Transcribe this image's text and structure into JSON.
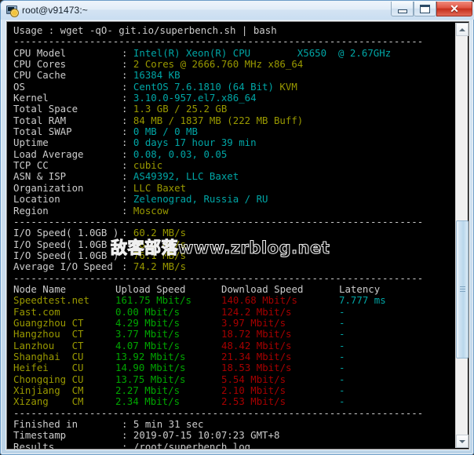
{
  "window": {
    "title": "root@v91473:~",
    "icon": "terminal-icon",
    "controls": {
      "minimize": "–",
      "maximize": "□",
      "close": "✕"
    }
  },
  "terminal": {
    "usage_line": "Usage : wget -qO- git.io/superbench.sh | bash",
    "divider": "----------------------------------------------------------------------",
    "sysinfo": [
      {
        "label": "CPU Model",
        "value": "Intel(R) Xeon(R) CPU        X5650  @ 2.67GHz",
        "color": "cyan"
      },
      {
        "label": "CPU Cores",
        "value": "2 Cores @ 2666.760 MHz x86_64",
        "color": "yellow"
      },
      {
        "label": "CPU Cache",
        "value": "16384 KB",
        "color": "cyan"
      },
      {
        "label": "OS",
        "value": "CentOS 7.6.1810 (64 Bit) ",
        "value2": "KVM",
        "color": "cyan",
        "color2": "yellow"
      },
      {
        "label": "Kernel",
        "value": "3.10.0-957.el7.x86_64",
        "color": "cyan"
      },
      {
        "label": "Total Space",
        "value": "1.3 GB / 25.2 GB",
        "color": "yellow"
      },
      {
        "label": "Total RAM",
        "value": "84 MB / 1837 MB (222 MB Buff)",
        "color": "yellow"
      },
      {
        "label": "Total SWAP",
        "value": "0 MB / 0 MB",
        "color": "cyan"
      },
      {
        "label": "Uptime",
        "value": "0 days 17 hour 39 min",
        "color": "cyan"
      },
      {
        "label": "Load Average",
        "value": "0.08, 0.03, 0.05",
        "color": "cyan"
      },
      {
        "label": "TCP CC",
        "value": "cubic",
        "color": "yellow"
      },
      {
        "label": "ASN & ISP",
        "value": "AS49392, LLC Baxet",
        "color": "cyan"
      },
      {
        "label": "Organization",
        "value": "LLC Baxet",
        "color": "yellow"
      },
      {
        "label": "Location",
        "value": "Zelenograd, Russia / RU",
        "color": "cyan"
      },
      {
        "label": "Region",
        "value": "Moscow",
        "color": "yellow"
      }
    ],
    "io": [
      {
        "label": "I/O Speed( 1.0GB )",
        "value": "60.2 MB/s",
        "color": "yellow"
      },
      {
        "label": "I/O Speed( 1.0GB )",
        "value": "86.2 MB/s",
        "color": "yellow"
      },
      {
        "label": "I/O Speed( 1.0GB )",
        "value": "76.1 MB/s",
        "color": "yellow"
      },
      {
        "label": "Average I/O Speed",
        "value": "74.2 MB/s",
        "color": "yellow"
      }
    ],
    "speedtest": {
      "headers": {
        "node": "Node Name",
        "upload": "Upload Speed",
        "download": "Download Speed",
        "latency": "Latency"
      },
      "rows": [
        {
          "node": "Speedtest.net",
          "upload": "161.75 Mbit/s",
          "download": "140.68 Mbit/s",
          "latency": "7.777 ms"
        },
        {
          "node": "Fast.com",
          "upload": "0.00 Mbit/s",
          "download": "124.2 Mbit/s",
          "latency": "-"
        },
        {
          "node": "Guangzhou CT",
          "upload": "4.29 Mbit/s",
          "download": "3.97 Mbit/s",
          "latency": "-"
        },
        {
          "node": "Hangzhou  CT",
          "upload": "3.77 Mbit/s",
          "download": "18.72 Mbit/s",
          "latency": "-"
        },
        {
          "node": "Lanzhou   CT",
          "upload": "4.07 Mbit/s",
          "download": "48.42 Mbit/s",
          "latency": "-"
        },
        {
          "node": "Shanghai  CU",
          "upload": "13.92 Mbit/s",
          "download": "21.34 Mbit/s",
          "latency": "-"
        },
        {
          "node": "Heifei    CU",
          "upload": "14.90 Mbit/s",
          "download": "18.53 Mbit/s",
          "latency": "-"
        },
        {
          "node": "Chongqing CU",
          "upload": "13.75 Mbit/s",
          "download": "5.54 Mbit/s",
          "latency": "-"
        },
        {
          "node": "Xinjiang  CM",
          "upload": "2.27 Mbit/s",
          "download": "2.10 Mbit/s",
          "latency": "-"
        },
        {
          "node": "Xizang    CM",
          "upload": "2.34 Mbit/s",
          "download": "2.53 Mbit/s",
          "latency": "-"
        }
      ]
    },
    "footer": [
      {
        "label": "Finished in",
        "value": "5 min 31 sec"
      },
      {
        "label": "Timestamp",
        "value": "2019-07-15 10:07:23 GMT+8"
      },
      {
        "label": "Results",
        "value": "/root/superbench.log"
      }
    ]
  },
  "watermark": {
    "text": "敌客部落www.zrblog.net"
  },
  "colors": {
    "background": "#000000",
    "text": "#cccccc",
    "cyan": "#00a6a6",
    "green": "#00a600",
    "red": "#a60000",
    "yellow": "#999900",
    "titlebar": "#d3e3f3",
    "close_button": "#c52f1d"
  }
}
